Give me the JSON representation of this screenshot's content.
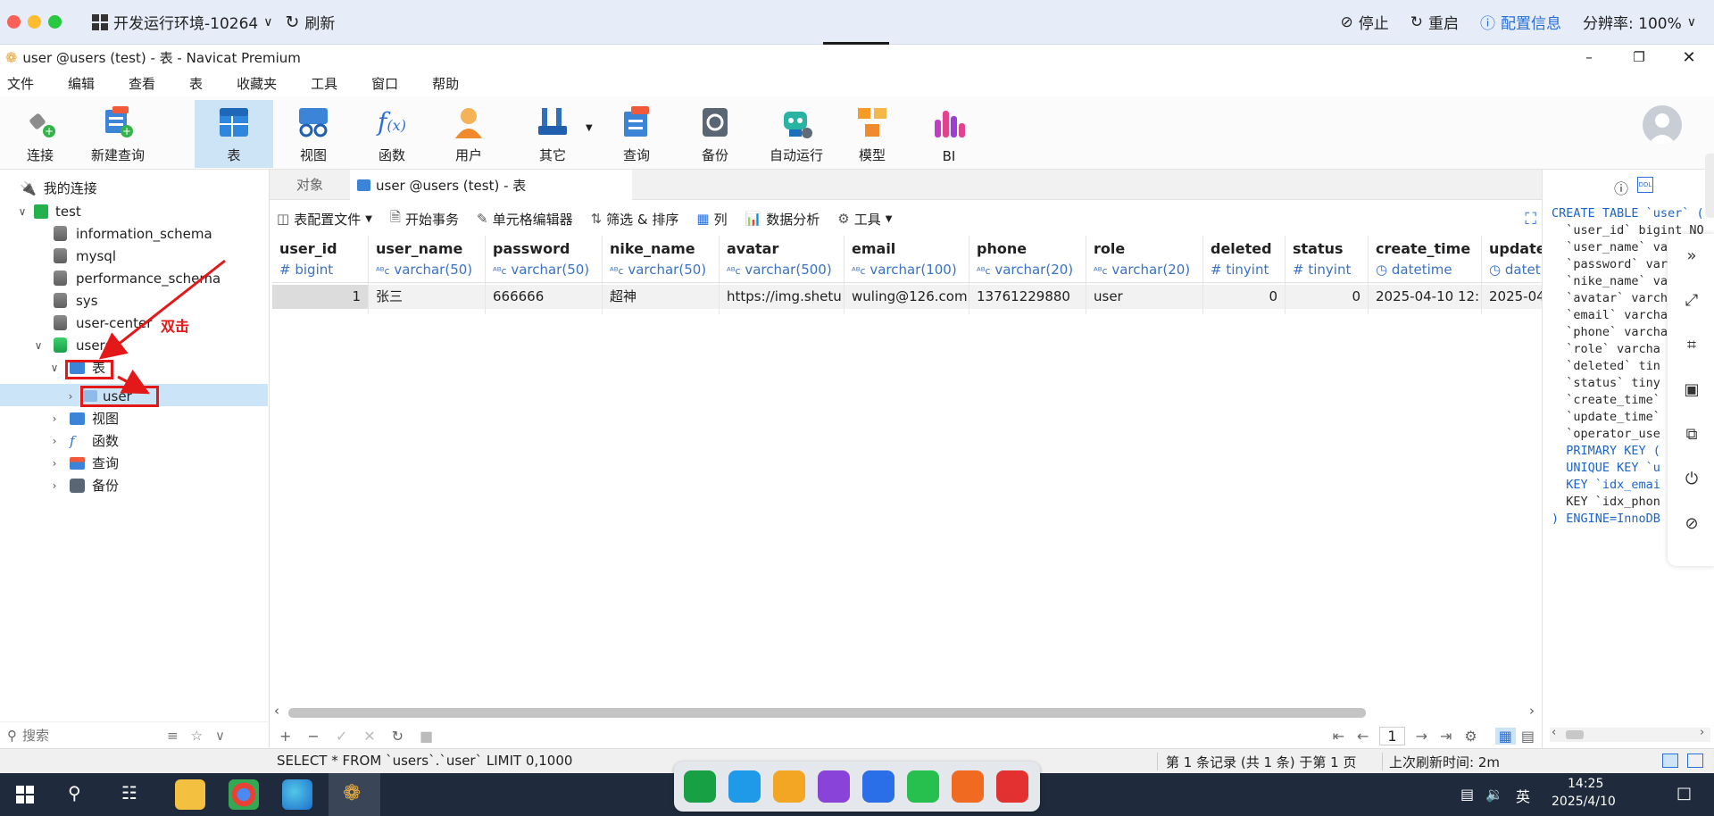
{
  "remote": {
    "env_label": "开发运行环境-10264",
    "refresh": "刷新",
    "stop": "停止",
    "restart": "重启",
    "config": "配置信息",
    "resolution": "分辨率: 100%"
  },
  "window": {
    "title": "user @users (test) - 表 - Navicat Premium"
  },
  "menu": [
    "文件",
    "编辑",
    "查看",
    "表",
    "收藏夹",
    "工具",
    "窗口",
    "帮助"
  ],
  "ribbon": {
    "connect": "连接",
    "new_query": "新建查询",
    "table": "表",
    "view": "视图",
    "function": "函数",
    "user": "用户",
    "other": "其它",
    "query": "查询",
    "backup": "备份",
    "auto_run": "自动运行",
    "model": "模型",
    "bi": "BI"
  },
  "tree": {
    "my_connections": "我的连接",
    "conn": "test",
    "databases": [
      "information_schema",
      "mysql",
      "performance_schema",
      "sys",
      "user-center"
    ],
    "open_db": "users",
    "tables_node": "表",
    "table_user": "user",
    "views": "视图",
    "functions": "函数",
    "queries": "查询",
    "backups": "备份"
  },
  "annotation": {
    "text": "双击",
    "color": "#e31919"
  },
  "search": {
    "placeholder": "搜索"
  },
  "tabs": {
    "objects": "对象",
    "active": "user @users (test) - 表"
  },
  "toolbar": {
    "profile": "表配置文件",
    "begin_tx": "开始事务",
    "cell_editor": "单元格编辑器",
    "filter_sort": "筛选 & 排序",
    "columns": "列",
    "analysis": "数据分析",
    "tools": "工具"
  },
  "columns": [
    {
      "name": "user_id",
      "type": "bigint"
    },
    {
      "name": "user_name",
      "type": "varchar(50)"
    },
    {
      "name": "password",
      "type": "varchar(50)"
    },
    {
      "name": "nike_name",
      "type": "varchar(50)"
    },
    {
      "name": "avatar",
      "type": "varchar(500)"
    },
    {
      "name": "email",
      "type": "varchar(100)"
    },
    {
      "name": "phone",
      "type": "varchar(20)"
    },
    {
      "name": "role",
      "type": "varchar(20)"
    },
    {
      "name": "deleted",
      "type": "tinyint"
    },
    {
      "name": "status",
      "type": "tinyint"
    },
    {
      "name": "create_time",
      "type": "datetime"
    },
    {
      "name": "update",
      "type": "datet"
    }
  ],
  "row": [
    "1",
    "张三",
    "666666",
    "超神",
    "https://img.shetu",
    "wuling@126.com",
    "13761229880",
    "user",
    "0",
    "0",
    "2025-04-10 12:",
    "2025-04-"
  ],
  "ddl": [
    "CREATE TABLE `user` (",
    "  `user_id` bigint NO",
    "  `user_name` varcha",
    "  `password` varcha",
    "  `nike_name` varcha",
    "  `avatar` varcha",
    "  `email` varcha",
    "  `phone` varcha",
    "  `role` varcha",
    "  `deleted` tin",
    "  `status` tiny",
    "  `create_time`",
    "  `update_time`",
    "  `operator_use",
    "  PRIMARY KEY (",
    "  UNIQUE KEY `u",
    "  KEY `idx_emai",
    "  KEY `idx_phon",
    ") ENGINE=InnoDB"
  ],
  "pager": {
    "page": "1"
  },
  "status": {
    "sql": "SELECT * FROM `users`.`user` LIMIT 0,1000",
    "records": "第 1 条记录 (共 1 条) 于第 1 页",
    "refresh": "上次刷新时间: 2m"
  },
  "taskbar": {
    "ime": "英",
    "time": "14:25",
    "date": "2025/4/10"
  }
}
